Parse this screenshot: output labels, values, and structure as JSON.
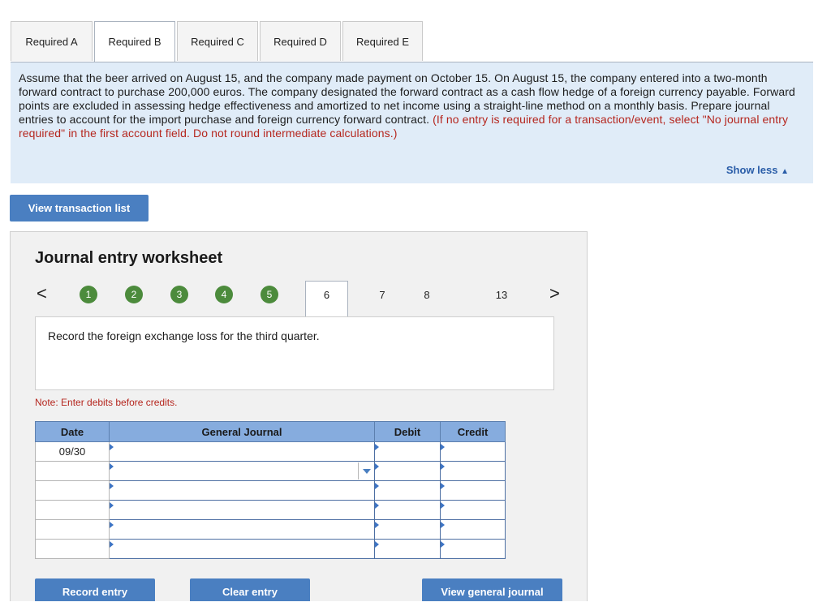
{
  "tabs": [
    "Required A",
    "Required B",
    "Required C",
    "Required D",
    "Required E"
  ],
  "active_tab": "Required B",
  "instructions": {
    "text": "Assume that the beer arrived on August 15, and the company made payment on October 15. On August 15, the company entered into a two-month forward contract to purchase 200,000 euros. The company designated the forward contract as a cash flow hedge of a foreign currency payable. Forward points are excluded in assessing hedge effectiveness and amortized to net income using a straight-line method on a monthly basis. Prepare journal entries to account for the import purchase and foreign currency forward contract.",
    "red_text": "(If no entry is required for a transaction/event, select \"No journal entry required\" in the first account field. Do not round intermediate calculations.)",
    "show_less": "Show less"
  },
  "view_transaction_list": "View transaction list",
  "worksheet": {
    "title": "Journal entry worksheet",
    "completed_steps": [
      "1",
      "2",
      "3",
      "4",
      "5"
    ],
    "active_step": "6",
    "remaining_steps": [
      "7",
      "8",
      "13"
    ],
    "description": "Record the foreign exchange loss for the third quarter.",
    "note": "Note: Enter debits before credits."
  },
  "table": {
    "headers": {
      "date": "Date",
      "journal": "General Journal",
      "debit": "Debit",
      "credit": "Credit"
    },
    "rows": [
      {
        "date": "09/30"
      },
      {
        "date": ""
      },
      {
        "date": ""
      },
      {
        "date": ""
      },
      {
        "date": ""
      },
      {
        "date": ""
      }
    ]
  },
  "buttons": {
    "record": "Record entry",
    "clear": "Clear entry",
    "view_journal": "View general journal"
  },
  "colors": {
    "accent": "#4a7fc1",
    "instruction_bg": "#e0ecf8",
    "step_done": "#4c8b3c",
    "alert_red": "#b5261e"
  }
}
